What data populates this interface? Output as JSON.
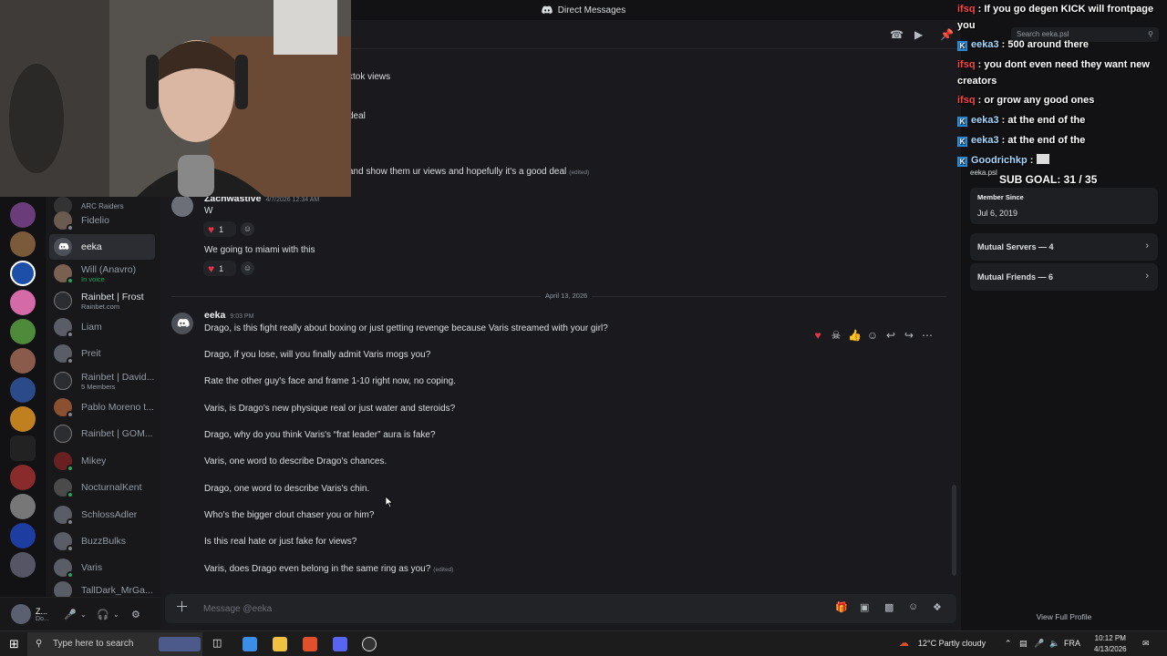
{
  "window": {
    "title": "Direct Messages"
  },
  "dm_list": {
    "items": [
      {
        "name": "",
        "sub": "ARC Raiders",
        "status": "on"
      },
      {
        "name": "Fidelio",
        "sub": "",
        "status": "off"
      },
      {
        "name": "eeka",
        "sub": "",
        "status": "off",
        "active": true
      },
      {
        "name": "Will (Anavro)",
        "sub": "In voice",
        "status": "on"
      },
      {
        "name": "Rainbet | Frost",
        "sub": "Rainbet.com",
        "status": "off"
      },
      {
        "name": "Liam",
        "sub": "",
        "status": "off"
      },
      {
        "name": "Preit",
        "sub": "",
        "status": "off"
      },
      {
        "name": "Rainbet | David...",
        "sub": "5 Members",
        "status": "off"
      },
      {
        "name": "Pablo Moreno t...",
        "sub": "",
        "status": "off"
      },
      {
        "name": "Rainbet | GOM...",
        "sub": "",
        "status": "off"
      },
      {
        "name": "Mikey",
        "sub": "",
        "status": "on"
      },
      {
        "name": "NocturnalKent",
        "sub": "",
        "status": "on"
      },
      {
        "name": "SchlossAdler",
        "sub": "",
        "status": "off"
      },
      {
        "name": "BuzzBulks",
        "sub": "",
        "status": "off"
      },
      {
        "name": "Varis",
        "sub": "",
        "status": "on"
      },
      {
        "name": "TallDark_MrGa...",
        "sub": "",
        "status": "off"
      }
    ]
  },
  "user_panel": {
    "name": "Z...",
    "status": "Do..."
  },
  "chat": {
    "partial_lines": [
      "ktok views",
      "deal",
      "and show them ur views and hopefully it's a good deal"
    ],
    "edited_label": "(edited)",
    "zach": {
      "author": "Zachwastive",
      "timestamp": "4/7/2026 12:34 AM",
      "line1": "W",
      "react1_count": "1",
      "line2": "We going to miami with this",
      "react2_count": "1"
    },
    "date_divider": "April 13, 2026",
    "eeka": {
      "author": "eeka",
      "timestamp": "9:03 PM",
      "lines": [
        "Drago, is this fight really about boxing or just getting revenge because Varis streamed with your girl?",
        "Drago, if you lose, will you finally admit Varis mogs you?",
        "Rate the other guy's face and frame 1-10 right now, no coping.",
        "Varis, is Drago's new physique real or just water and steroids?",
        "Drago, why do you think Varis's “frat leader” aura is fake?",
        "Varis, one word to describe Drago's chances.",
        "Drago, one word to describe Varis's chin.",
        "Who's the bigger clout chaser you or him?",
        "Is this real hate or just fake for views?",
        "Varis, does Drago even belong in the same ring as you?"
      ]
    },
    "composer_placeholder": "Message @eeka"
  },
  "profile": {
    "search_placeholder": "Search eeka.psl",
    "handle": "eeka.psl",
    "member_since_label": "Member Since",
    "member_since": "Jul 6, 2019",
    "mutual_servers": "Mutual Servers — 4",
    "mutual_friends": "Mutual Friends — 6",
    "view_full": "View Full Profile"
  },
  "overlay": {
    "messages": [
      {
        "user": "ifsq",
        "text": ": If you go degen KICK will frontpage",
        "badge": false
      },
      {
        "user": "",
        "text": "you",
        "badge": false
      },
      {
        "user": "eeka3",
        "text": ": 500 around there",
        "badge": true
      },
      {
        "user": "ifsq",
        "text": ": you dont even need they want new",
        "badge": false
      },
      {
        "user": "",
        "text": "creators",
        "badge": false
      },
      {
        "user": "ifsq",
        "text": ": or grow any good ones",
        "badge": false
      },
      {
        "user": "eeka3",
        "text": ": at the end of the",
        "badge": true
      },
      {
        "user": "eeka3",
        "text": ": at the end of the",
        "badge": true
      },
      {
        "user": "Goodrichkp",
        "text": ":",
        "badge": true
      }
    ],
    "sub_goal": "SUB GOAL: 31 / 35"
  },
  "taskbar": {
    "search_text": "Type here to search",
    "weather": "12°C  Partly cloudy",
    "lang": "FRA",
    "time": "10:12 PM",
    "date": "4/13/2026"
  },
  "colors": {
    "accent": "#5865f2",
    "online": "#23a55a",
    "heart": "#e6334a",
    "chat_user": "#ff4444"
  }
}
